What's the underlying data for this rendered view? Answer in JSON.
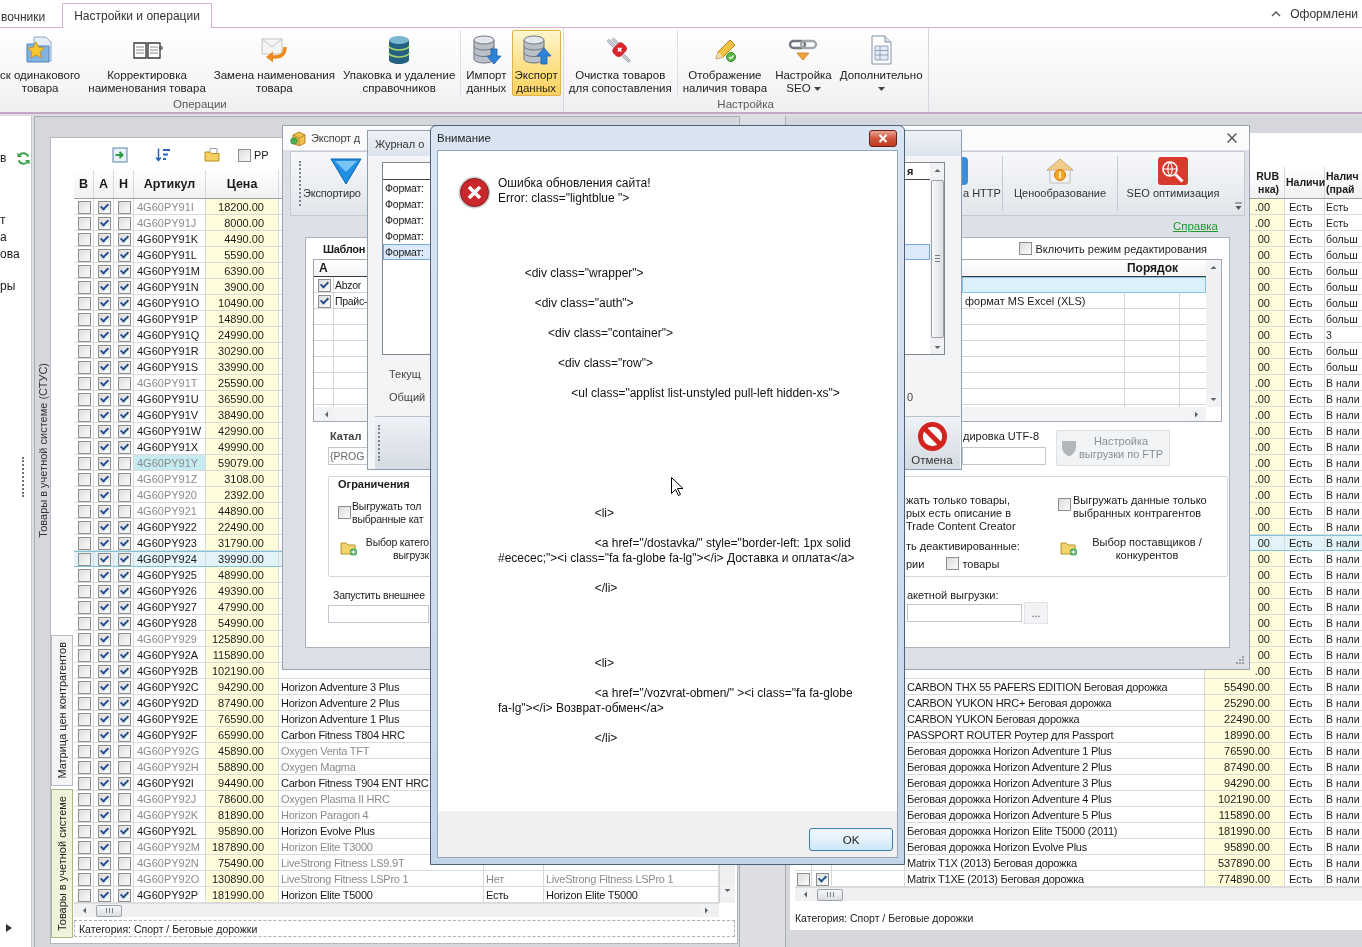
{
  "ribbon": {
    "tabs": [
      {
        "label": "вочники",
        "selected": false
      },
      {
        "label": "Настройки и операции",
        "selected": true
      }
    ],
    "appearance_menu": "Оформлени",
    "groups": [
      {
        "label": "Операции",
        "sections": [
          [
            {
              "kind": "star-folder",
              "label": "ск одинакового\nтовара",
              "selected": false,
              "dropdown": false
            },
            {
              "kind": "book",
              "label": "Корректировка\nнаименования товара",
              "selected": false,
              "dropdown": false
            },
            {
              "kind": "envelope-arrow",
              "label": "Замена наименования\nтовара",
              "selected": false,
              "dropdown": false
            },
            {
              "kind": "database",
              "label": "Упаковка и удаление\nсправочников",
              "selected": false,
              "dropdown": false
            }
          ],
          [
            {
              "kind": "database-down",
              "label": "Импорт\nданных",
              "selected": false,
              "dropdown": false
            },
            {
              "kind": "database-up",
              "label": "Экспорт\nданных",
              "selected": true,
              "dropdown": false
            }
          ]
        ]
      },
      {
        "label": "Настройка",
        "sections": [
          [
            {
              "kind": "multitool",
              "label": "Очистка товаров\nдля сопоставления",
              "selected": false,
              "dropdown": false
            }
          ],
          [
            {
              "kind": "pencil-check",
              "label": "Отображение\nналичия товара",
              "selected": false,
              "dropdown": false
            },
            {
              "kind": "chain",
              "label": "Настройка\nSEO",
              "selected": false,
              "dropdown": true
            },
            {
              "kind": "document",
              "label": "Дополнительно",
              "selected": false,
              "dropdown": true
            }
          ]
        ]
      }
    ]
  },
  "left_nav": {
    "sections": [
      [
        "в"
      ],
      [
        "т",
        "а",
        "ова"
      ],
      [
        "ры"
      ]
    ]
  },
  "stus_panel": {
    "caption": "Товары в учетной системе (СТУС)",
    "toolbar": {
      "checkbox_label": "РР",
      "checked": false
    },
    "table": {
      "columns": [
        "В",
        "А",
        "Н",
        "Артикул",
        "Цена"
      ],
      "rows": [
        {
          "check_1": false,
          "check_2": true,
          "check_3": false,
          "article": "4G60PY91I",
          "price": "18200.00",
          "selected": false,
          "highlighted": false
        },
        {
          "check_1": false,
          "check_2": true,
          "check_3": false,
          "article": "4G60PY91J",
          "price": "8000.00",
          "selected": false,
          "highlighted": false
        },
        {
          "check_1": false,
          "check_2": true,
          "check_3": true,
          "article": "4G60PY91K",
          "price": "4490.00",
          "selected": false,
          "highlighted": false
        },
        {
          "check_1": false,
          "check_2": true,
          "check_3": true,
          "article": "4G60PY91L",
          "price": "5590.00",
          "selected": false,
          "highlighted": false
        },
        {
          "check_1": false,
          "check_2": true,
          "check_3": true,
          "article": "4G60PY91M",
          "price": "6390.00",
          "selected": false,
          "highlighted": false
        },
        {
          "check_1": false,
          "check_2": true,
          "check_3": true,
          "article": "4G60PY91N",
          "price": "3900.00",
          "selected": false,
          "highlighted": false
        },
        {
          "check_1": false,
          "check_2": true,
          "check_3": true,
          "article": "4G60PY91O",
          "price": "10490.00",
          "selected": false,
          "highlighted": false
        },
        {
          "check_1": false,
          "check_2": true,
          "check_3": true,
          "article": "4G60PY91P",
          "price": "14890.00",
          "selected": false,
          "highlighted": false
        },
        {
          "check_1": false,
          "check_2": true,
          "check_3": true,
          "article": "4G60PY91Q",
          "price": "24990.00",
          "selected": false,
          "highlighted": false
        },
        {
          "check_1": false,
          "check_2": true,
          "check_3": true,
          "article": "4G60PY91R",
          "price": "30290.00",
          "selected": false,
          "highlighted": false
        },
        {
          "check_1": false,
          "check_2": true,
          "check_3": true,
          "article": "4G60PY91S",
          "price": "33990.00",
          "selected": false,
          "highlighted": false
        },
        {
          "check_1": false,
          "check_2": true,
          "check_3": false,
          "article": "4G60PY91T",
          "price": "25590.00",
          "selected": false,
          "highlighted": false
        },
        {
          "check_1": false,
          "check_2": true,
          "check_3": true,
          "article": "4G60PY91U",
          "price": "36590.00",
          "selected": false,
          "highlighted": false
        },
        {
          "check_1": false,
          "check_2": true,
          "check_3": true,
          "article": "4G60PY91V",
          "price": "38490.00",
          "selected": false,
          "highlighted": false
        },
        {
          "check_1": false,
          "check_2": true,
          "check_3": true,
          "article": "4G60PY91W",
          "price": "42990.00",
          "selected": false,
          "highlighted": false
        },
        {
          "check_1": false,
          "check_2": true,
          "check_3": true,
          "article": "4G60PY91X",
          "price": "49990.00",
          "selected": false,
          "highlighted": false
        },
        {
          "check_1": false,
          "check_2": true,
          "check_3": false,
          "article": "4G60PY91Y",
          "price": "59079.00",
          "selected": false,
          "highlighted": true
        },
        {
          "check_1": false,
          "check_2": true,
          "check_3": false,
          "article": "4G60PY91Z",
          "price": "3108.00",
          "selected": false,
          "highlighted": false
        },
        {
          "check_1": false,
          "check_2": true,
          "check_3": false,
          "article": "4G60PY920",
          "price": "2392.00",
          "selected": false,
          "highlighted": false
        },
        {
          "check_1": false,
          "check_2": true,
          "check_3": false,
          "article": "4G60PY921",
          "price": "44890.00",
          "selected": false,
          "highlighted": false
        },
        {
          "check_1": false,
          "check_2": true,
          "check_3": true,
          "article": "4G60PY922",
          "price": "22490.00",
          "selected": false,
          "highlighted": false
        },
        {
          "check_1": false,
          "check_2": true,
          "check_3": true,
          "article": "4G60PY923",
          "price": "31790.00",
          "selected": false,
          "highlighted": false
        },
        {
          "check_1": false,
          "check_2": true,
          "check_3": true,
          "article": "4G60PY924",
          "price": "39990.00",
          "selected": true,
          "highlighted": false
        },
        {
          "check_1": false,
          "check_2": true,
          "check_3": true,
          "article": "4G60PY925",
          "price": "48990.00",
          "selected": false,
          "highlighted": false
        },
        {
          "check_1": false,
          "check_2": true,
          "check_3": true,
          "article": "4G60PY926",
          "price": "49390.00",
          "selected": false,
          "highlighted": false
        },
        {
          "check_1": false,
          "check_2": true,
          "check_3": true,
          "article": "4G60PY927",
          "price": "47990.00",
          "selected": false,
          "highlighted": false
        },
        {
          "check_1": false,
          "check_2": true,
          "check_3": true,
          "article": "4G60PY928",
          "price": "54990.00",
          "selected": false,
          "highlighted": false
        },
        {
          "check_1": false,
          "check_2": true,
          "check_3": false,
          "article": "4G60PY929",
          "price": "125890.00",
          "selected": false,
          "highlighted": false
        },
        {
          "check_1": false,
          "check_2": true,
          "check_3": true,
          "article": "4G60PY92A",
          "price": "115890.00",
          "selected": false,
          "highlighted": false
        },
        {
          "check_1": false,
          "check_2": true,
          "check_3": true,
          "article": "4G60PY92B",
          "price": "102190.00",
          "selected": false,
          "highlighted": false
        },
        {
          "check_1": false,
          "check_2": true,
          "check_3": true,
          "article": "4G60PY92C",
          "price": "94290.00",
          "selected": false,
          "highlighted": false,
          "name": "Horizon Adventure 3 Plus"
        },
        {
          "check_1": false,
          "check_2": true,
          "check_3": true,
          "article": "4G60PY92D",
          "price": "87490.00",
          "selected": false,
          "highlighted": false,
          "name": "Horizon Adventure 2 Plus"
        },
        {
          "check_1": false,
          "check_2": true,
          "check_3": true,
          "article": "4G60PY92E",
          "price": "76590.00",
          "selected": false,
          "highlighted": false,
          "name": "Horizon Adventure 1 Plus"
        },
        {
          "check_1": false,
          "check_2": true,
          "check_3": true,
          "article": "4G60PY92F",
          "price": "65990.00",
          "selected": false,
          "highlighted": false,
          "name": "Carbon Fitness T804 HRC"
        },
        {
          "check_1": false,
          "check_2": true,
          "check_3": false,
          "article": "4G60PY92G",
          "price": "45890.00",
          "selected": false,
          "highlighted": false,
          "name": "Oxygen Venta TFT"
        },
        {
          "check_1": false,
          "check_2": true,
          "check_3": false,
          "article": "4G60PY92H",
          "price": "58890.00",
          "selected": false,
          "highlighted": false,
          "name": "Oxygen Magma"
        },
        {
          "check_1": false,
          "check_2": true,
          "check_3": true,
          "article": "4G60PY92I",
          "price": "94490.00",
          "selected": false,
          "highlighted": false,
          "name": "Carbon Fitness T904 ENT HRC"
        },
        {
          "check_1": false,
          "check_2": true,
          "check_3": false,
          "article": "4G60PY92J",
          "price": "78600.00",
          "selected": false,
          "highlighted": false,
          "name": "Oxygen Plasma II HRC"
        },
        {
          "check_1": false,
          "check_2": true,
          "check_3": false,
          "article": "4G60PY92K",
          "price": "81890.00",
          "selected": false,
          "highlighted": false,
          "name": "Horizon Paragon 4"
        },
        {
          "check_1": false,
          "check_2": true,
          "check_3": true,
          "article": "4G60PY92L",
          "price": "95890.00",
          "selected": false,
          "highlighted": false,
          "name": "Horizon Evolve Plus"
        },
        {
          "check_1": false,
          "check_2": true,
          "check_3": false,
          "article": "4G60PY92M",
          "price": "187890.00",
          "selected": false,
          "highlighted": false,
          "name": "Horizon Elite T3000"
        },
        {
          "check_1": false,
          "check_2": true,
          "check_3": false,
          "article": "4G60PY92N",
          "price": "75490.00",
          "selected": false,
          "highlighted": false,
          "name": "LiveStrong Fitness LS9.9T"
        },
        {
          "check_1": false,
          "check_2": true,
          "check_3": false,
          "article": "4G60PY92O",
          "price": "130890.00",
          "selected": false,
          "highlighted": false,
          "name": "LiveStrong Fitness LSPro 1",
          "stock": "Нет",
          "name_2": "LiveStrong Fitness LSPro 1"
        },
        {
          "check_1": false,
          "check_2": true,
          "check_3": true,
          "article": "4G60PY92P",
          "price": "181990.00",
          "selected": false,
          "highlighted": false,
          "name": "Horizon Elite T5000",
          "stock": "Есть",
          "name_2": "Horizon Elite T5000"
        }
      ]
    },
    "tabs": [
      {
        "label": "Матрица цен контрагентов",
        "selected": false
      },
      {
        "label": "Товары в учетной системе",
        "selected": true
      }
    ],
    "status": "Категория: Спорт / Беговые дорожки"
  },
  "matrix_panel": {
    "columns": [
      "RUB\nнка)",
      "Наличи",
      "Налич\n(прай"
    ],
    "rows": [
      {
        "price": ".00",
        "stock": "Есть",
        "stock_price": "Есть",
        "selected": false
      },
      {
        "price": ".00",
        "stock": "Есть",
        "stock_price": "Есть",
        "selected": false
      },
      {
        "price": "00",
        "stock": "Есть",
        "stock_price": "больш",
        "selected": false
      },
      {
        "price": "00",
        "stock": "Есть",
        "stock_price": "больш",
        "selected": false
      },
      {
        "price": "00",
        "stock": "Есть",
        "stock_price": "больш",
        "selected": false
      },
      {
        "price": "00",
        "stock": "Есть",
        "stock_price": "больш",
        "selected": false
      },
      {
        "price": "00",
        "stock": "Есть",
        "stock_price": "больш",
        "selected": false
      },
      {
        "price": "00",
        "stock": "Есть",
        "stock_price": "больш",
        "selected": false
      },
      {
        "price": "00",
        "stock": "Есть",
        "stock_price": "3",
        "selected": false
      },
      {
        "price": "00",
        "stock": "Есть",
        "stock_price": "больш",
        "selected": false
      },
      {
        "price": "00",
        "stock": "Есть",
        "stock_price": "больш",
        "selected": false
      },
      {
        "price": ".00",
        "stock": "Есть",
        "stock_price": "В нали",
        "selected": false
      },
      {
        "price": ".00",
        "stock": "Есть",
        "stock_price": "В нали",
        "selected": false
      },
      {
        "price": ".00",
        "stock": "Есть",
        "stock_price": "В нали",
        "selected": false
      },
      {
        "price": ".00",
        "stock": "Есть",
        "stock_price": "В нали",
        "selected": false
      },
      {
        "price": ".00",
        "stock": "Есть",
        "stock_price": "В нали",
        "selected": false
      },
      {
        "price": ".00",
        "stock": "Есть",
        "stock_price": "В нали",
        "selected": false
      },
      {
        "price": ".00",
        "stock": "Есть",
        "stock_price": "В нали",
        "selected": false
      },
      {
        "price": ".00",
        "stock": "Есть",
        "stock_price": "В нали",
        "selected": false
      },
      {
        "price": ".00",
        "stock": "Есть",
        "stock_price": "В нали",
        "selected": false
      },
      {
        "price": "00",
        "stock": "Есть",
        "stock_price": "В нали",
        "selected": false
      },
      {
        "price": "00",
        "stock": "Есть",
        "stock_price": "В нали",
        "selected": true
      },
      {
        "price": "00",
        "stock": "Есть",
        "stock_price": "В нали",
        "selected": false
      },
      {
        "price": "00",
        "stock": "Есть",
        "stock_price": "В нали",
        "selected": false
      },
      {
        "price": "00",
        "stock": "Есть",
        "stock_price": "В нали",
        "selected": false
      },
      {
        "price": "00",
        "stock": "Есть",
        "stock_price": "В нали",
        "selected": false
      },
      {
        "price": "00",
        "stock": "Есть",
        "stock_price": "В нали",
        "selected": false
      },
      {
        "price": "00",
        "stock": "Есть",
        "stock_price": "В нали",
        "selected": false
      },
      {
        "price": "00",
        "stock": "Есть",
        "stock_price": "В нали",
        "selected": false
      },
      {
        "price": ".00",
        "stock": "Есть",
        "stock_price": "В нали",
        "selected": false
      },
      {
        "name": "CARBON THX 55 PAFERS EDITION Беговая дорожка",
        "price": "55490.00",
        "stock": "Есть",
        "stock_price": "В нали",
        "selected": false
      },
      {
        "name": "CARBON YUKON HRC+ Беговая дорожка",
        "price": "25290.00",
        "stock": "Есть",
        "stock_price": "В нали",
        "selected": false
      },
      {
        "name": "CARBON YUKON Беговая дорожка",
        "price": "22490.00",
        "stock": "Есть",
        "stock_price": "В нали",
        "selected": false
      },
      {
        "name": "PASSPORT ROUTER Роутер для Passport",
        "price": "18990.00",
        "stock": "Есть",
        "stock_price": "В нали",
        "selected": false
      },
      {
        "name": "Беговая дорожка Horizon Adventure 1 Plus",
        "price": "76590.00",
        "stock": "Есть",
        "stock_price": "В нали",
        "selected": false
      },
      {
        "name": "Беговая дорожка Horizon Adventure 2 Plus",
        "price": "87490.00",
        "stock": "Есть",
        "stock_price": "В нали",
        "selected": false
      },
      {
        "name": "Беговая дорожка Horizon Adventure 3 Plus",
        "price": "94290.00",
        "stock": "Есть",
        "stock_price": "В нали",
        "selected": false
      },
      {
        "name": "Беговая дорожка Horizon Adventure 4 Plus",
        "price": "102190.00",
        "stock": "Есть",
        "stock_price": "В нали",
        "selected": false
      },
      {
        "name": "Беговая дорожка Horizon Adventure 5 Plus",
        "price": "115890.00",
        "stock": "Есть",
        "stock_price": "В нали",
        "selected": false
      },
      {
        "name": "Беговая дорожка Horizon Elite T5000 (2011)",
        "price": "181990.00",
        "stock": "Есть",
        "stock_price": "В нали",
        "selected": false
      },
      {
        "name": "Беговая дорожка Horizon Evolve Plus",
        "price": "95890.00",
        "stock": "Есть",
        "stock_price": "В нали",
        "selected": false
      },
      {
        "name": "Matrix T1X (2013) Беговая дорожка",
        "price": "537890.00",
        "stock": "Есть",
        "stock_price": "В нали",
        "selected": false
      },
      {
        "name": "Matrix T1XE (2013) Беговая дорожка",
        "price": "774890.00",
        "stock": "Есть",
        "stock_price": "В нали",
        "selected": false,
        "check_1": false,
        "check_2": true
      }
    ],
    "status": "Категория: Спорт / Беговые дорожки"
  },
  "export_window": {
    "title": "Экспорт д",
    "toolbar": [
      {
        "kind": "triangle",
        "label": "Экспортиро"
      },
      {
        "kind": "tile",
        "label": "а HTTP"
      },
      {
        "kind": "house-coin",
        "label": "Ценообразование"
      },
      {
        "kind": "globe-search",
        "label": "SEO оптимизация"
      }
    ],
    "help_link": "Справка",
    "template": {
      "title": "Шаблон",
      "edit_mode": {
        "label": "Включить режим редактирования",
        "checked": false
      },
      "columns": [
        "А",
        "Порядок"
      ],
      "rows": [
        {
          "checked": true,
          "selected": true,
          "name_start": "Abzor"
        },
        {
          "checked": true,
          "selected": false,
          "name_start": "Прайс-",
          "name_end": "формат MS Excel (XLS)"
        }
      ]
    },
    "catalog": {
      "label": "Катал",
      "value": "{PROG"
    },
    "encoding": {
      "label": "дировка UTF-8"
    },
    "ftp_button": {
      "label": "Настройка\nвыгрузки по FTP",
      "disabled": true
    },
    "limits": {
      "title": "Ограничения",
      "only_selected_categories": {
        "label": "Выгружать тол\nвыбранные кат",
        "checked": false
      },
      "pick_categories": "Выбор катего\nвыгрузк",
      "only_described": "жать только товары,\nрых есть описание в\nTrade Content Creator",
      "deactivated": {
        "label": "ть деактивированные:",
        "categories_label": "рии",
        "goods": {
          "label": "товары",
          "checked": false
        }
      },
      "only_partners": {
        "label": "Выгружать данные только\nвыбранных контрагентов",
        "checked": false
      },
      "pick_suppliers": "Выбор поставщиков /\nконкурентов"
    },
    "external": {
      "label": "Запустить внешнее"
    },
    "batch": {
      "label": "акетной выгрузки:",
      "button": "..."
    }
  },
  "log_window": {
    "title": "Журнал о",
    "column_fragment": "я",
    "rows": [
      {
        "label": "Формат:",
        "selected": false
      },
      {
        "label": "Формат:",
        "selected": false
      },
      {
        "label": "Формат:",
        "selected": false
      },
      {
        "label": "Формат:",
        "selected": false
      },
      {
        "label": "Формат:",
        "selected": true
      }
    ],
    "current_label": "Текущ",
    "total_label": "Общий",
    "total_value": "0",
    "cancel_button": "Отмена"
  },
  "alert": {
    "title": "Внимание",
    "message": "Ошибка обновления сайта!\nError: class=\"lightblue \">\n\n\n\n\n        <div class=\"wrapper\">\n\n           <div class=\"auth\">\n\n               <div class=\"container\">\n\n                  <div class=\"row\">\n\n                      <ul class=\"applist list-unstyled pull-left hidden-xs\">\n\n\n\n\n\n\n\n                             <li>\n\n                             <a href=\"/dostavka/\" style=\"border-left: 1px solid\n#ececec;\"><i class=\"fa fa-globe fa-lg\"></i> Доставка и оплата</a>\n\n                             </li>\n\n\n\n\n                             <li>\n\n                             <a href=\"/vozvrat-obmen/\" ><i class=\"fa fa-globe\nfa-lg\"></i> Возврат-обмен</a>\n\n                             </li>",
    "ok_button": "OK"
  }
}
